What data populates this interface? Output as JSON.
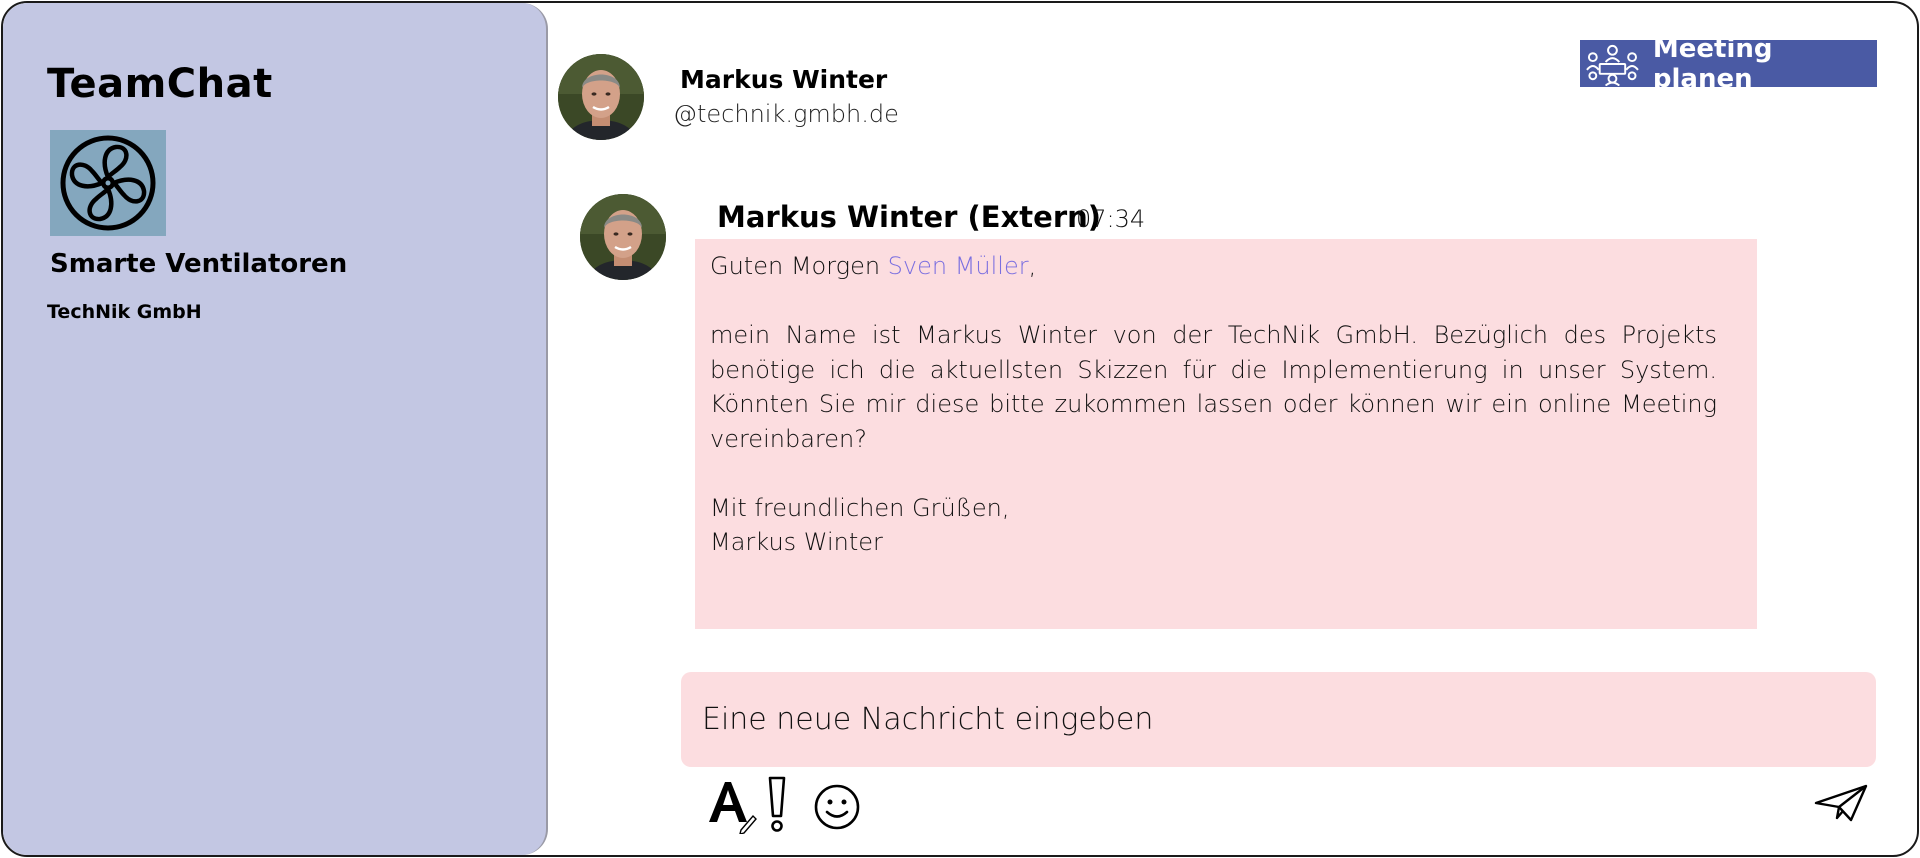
{
  "sidebar": {
    "app_title": "TeamChat",
    "team_logo_icon": "fan-icon",
    "team_name": "Smarte Ventilatoren",
    "company_name": "TechNik GmbH"
  },
  "header": {
    "contact_name": "Markus Winter",
    "contact_email": "@technik.gmbh.de",
    "meeting_button_label": "Meeting planen",
    "meeting_button_icon": "meeting-icon"
  },
  "message": {
    "sender": "Markus Winter (Extern)",
    "time": "07:34",
    "greeting_prefix": "Guten Morgen ",
    "mention": "Sven Müller",
    "greeting_suffix": ",",
    "body": "mein Name ist Markus Winter von der TechNik GmbH. Bezüglich des Projekts benötige ich die aktuellsten Skizzen für die Implementierung in unser System. Könnten Sie mir diese bitte zukommen lassen oder können wir ein online Meeting vereinbaren?",
    "closing": "Mit freundlichen Grüßen,",
    "signature": "Markus Winter"
  },
  "compose": {
    "placeholder": "Eine neue Nachricht eingeben"
  },
  "toolbar": {
    "icons": [
      "format-text-icon",
      "important-icon",
      "emoji-icon",
      "send-icon"
    ]
  },
  "colors": {
    "sidebar_bg": "#c3c7e3",
    "bubble_bg": "#fcdde0",
    "button_bg": "#4a5aa4",
    "mention": "#7b6fe0",
    "logo_bg": "#84a7be"
  }
}
